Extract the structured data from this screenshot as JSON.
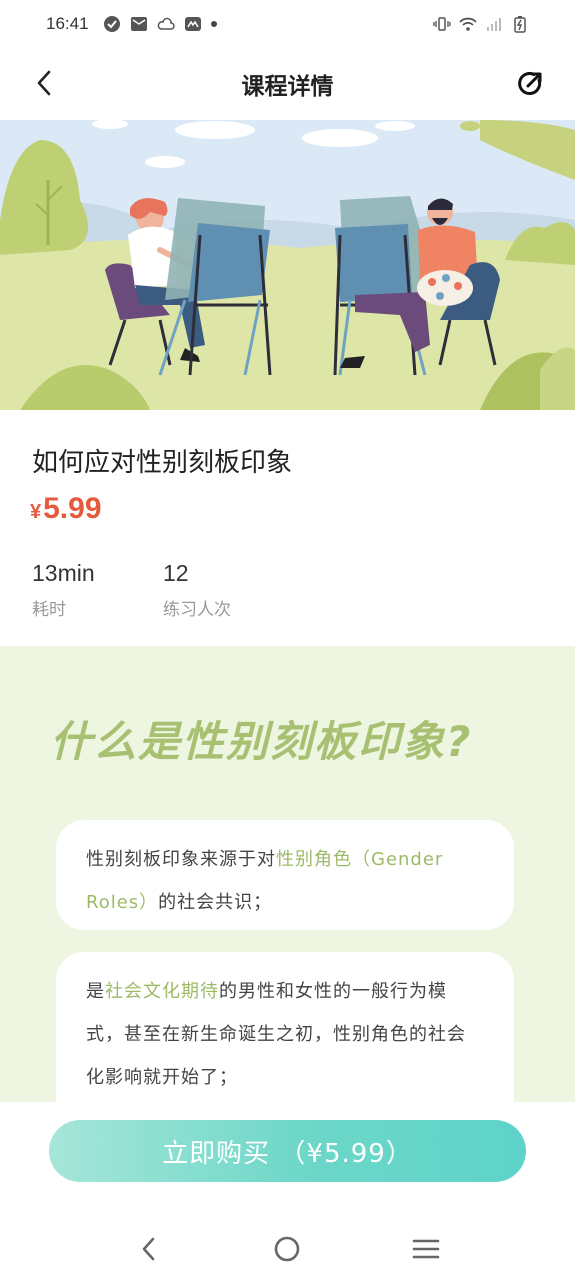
{
  "status_bar": {
    "time": "16:41",
    "left_icons": [
      "check-circle-icon",
      "mail-icon",
      "cloud-icon",
      "app-icon",
      "dot-icon"
    ],
    "right_icons": [
      "vibrate-icon",
      "wifi-icon",
      "signal-icon",
      "battery-charging-icon"
    ]
  },
  "header": {
    "title": "课程详情",
    "back_icon": "back-arrow-icon",
    "share_icon": "share-icon"
  },
  "banner": {
    "image": "two-people-painting-outdoors-illustration"
  },
  "course": {
    "title": "如何应对性别刻板印象",
    "price_symbol": "¥",
    "price": "5.99",
    "stats": [
      {
        "value": "13min",
        "label": "耗时"
      },
      {
        "value": "12",
        "label": "练习人次"
      }
    ]
  },
  "content": {
    "heading": "什么是性别刻板印象?",
    "cards": [
      {
        "segments": [
          {
            "text": "性别刻板印象来源于对",
            "highlight": false
          },
          {
            "text": "性别角色（Gender Roles）",
            "highlight": true
          },
          {
            "text": "的社会共识；",
            "highlight": false
          }
        ]
      },
      {
        "segments": [
          {
            "text": "是",
            "highlight": false
          },
          {
            "text": "社会文化期待",
            "highlight": true
          },
          {
            "text": "的男性和女性的一般行为模式，甚至在新生命诞生之初，性别角色的社会化影响就开始了；",
            "highlight": false
          }
        ]
      }
    ]
  },
  "buy_button": {
    "label": "立即购买 （¥5.99）"
  },
  "nav_bar": {
    "icons": [
      "nav-back-icon",
      "nav-home-icon",
      "nav-menu-icon"
    ]
  },
  "colors": {
    "price": "#e55a3c",
    "accent_green": "#a8c071",
    "content_bg": "#eef5e0",
    "button_start": "#a6e6d8",
    "button_end": "#5ed3c9"
  }
}
